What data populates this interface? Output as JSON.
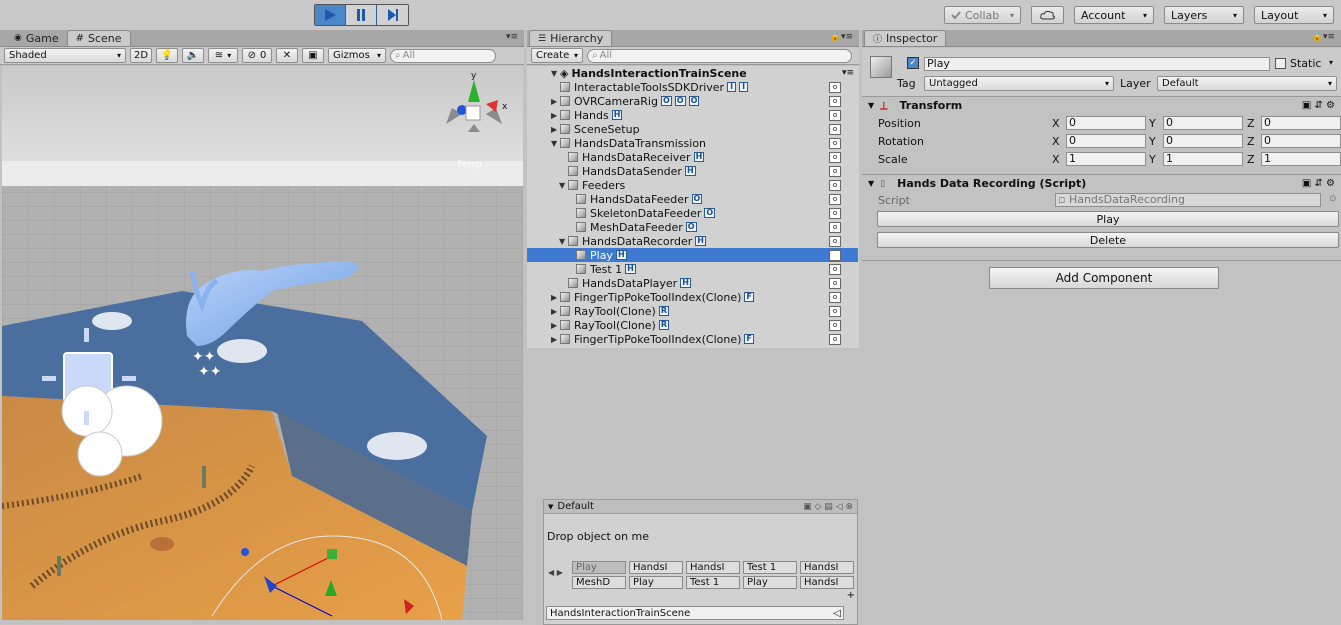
{
  "toolbar": {
    "collab_label": "Collab",
    "account_label": "Account",
    "layers_label": "Layers",
    "layout_label": "Layout"
  },
  "scene_panel": {
    "tab_game": "Game",
    "tab_scene": "Scene",
    "shading_mode": "Shaded",
    "mode_2d": "2D",
    "hidden_count": "0",
    "gizmos_label": "Gizmos",
    "search_placeholder": "All",
    "gizmo_axis_y": "y",
    "gizmo_axis_x": "x",
    "gizmo_view": "Persp"
  },
  "hierarchy_panel": {
    "tab_title": "Hierarchy",
    "create_label": "Create",
    "search_placeholder": "All",
    "scene_name": "HandsInteractionTrainScene",
    "rows": [
      {
        "label": "InteractableToolsSDKDriver",
        "badges": [
          "I",
          "I"
        ]
      },
      {
        "label": "OVRCameraRig",
        "badges": [
          "O",
          "O",
          "O"
        ]
      },
      {
        "label": "Hands",
        "badges": [
          "H"
        ]
      },
      {
        "label": "SceneSetup",
        "badges": []
      },
      {
        "label": "HandsDataTransmission",
        "badges": []
      },
      {
        "label": "HandsDataReceiver",
        "badges": [
          "H"
        ]
      },
      {
        "label": "HandsDataSender",
        "badges": [
          "H"
        ]
      },
      {
        "label": "Feeders",
        "badges": []
      },
      {
        "label": "HandsDataFeeder",
        "badges": [
          "O"
        ]
      },
      {
        "label": "SkeletonDataFeeder",
        "badges": [
          "O"
        ]
      },
      {
        "label": "MeshDataFeeder",
        "badges": [
          "O"
        ]
      },
      {
        "label": "HandsDataRecorder",
        "badges": [
          "H"
        ]
      },
      {
        "label": "Play",
        "badges": [
          "H"
        ]
      },
      {
        "label": "Test 1",
        "badges": [
          "H"
        ]
      },
      {
        "label": "HandsDataPlayer",
        "badges": [
          "H"
        ]
      },
      {
        "label": "FingerTipPokeToolIndex(Clone)",
        "badges": [
          "F"
        ]
      },
      {
        "label": "RayTool(Clone)",
        "badges": [
          "R"
        ]
      },
      {
        "label": "RayTool(Clone)",
        "badges": [
          "R"
        ]
      },
      {
        "label": "FingerTipPokeToolIndex(Clone)",
        "badges": [
          "F"
        ]
      }
    ]
  },
  "default_panel": {
    "title": "Default",
    "drop_hint": "Drop object on me",
    "slots_row1": [
      "Play",
      "HandsI",
      "HandsI",
      "Test 1",
      "HandsI"
    ],
    "slots_row2": [
      "MeshD",
      "Play",
      "Test 1",
      "Play",
      "HandsI"
    ],
    "scene_field": "HandsInteractionTrainScene"
  },
  "inspector": {
    "tab_title": "Inspector",
    "object_name": "Play",
    "static_label": "Static",
    "tag_label": "Tag",
    "tag_value": "Untagged",
    "layer_label": "Layer",
    "layer_value": "Default",
    "transform_title": "Transform",
    "position_label": "Position",
    "rotation_label": "Rotation",
    "scale_label": "Scale",
    "axis_x": "X",
    "axis_y": "Y",
    "axis_z": "Z",
    "position": [
      "0",
      "0",
      "0"
    ],
    "rotation": [
      "0",
      "0",
      "0"
    ],
    "scale": [
      "1",
      "1",
      "1"
    ],
    "script_component_title": "Hands Data Recording (Script)",
    "script_label": "Script",
    "script_value": "HandsDataRecording",
    "play_button": "Play",
    "delete_button": "Delete",
    "add_component_button": "Add Component"
  },
  "colors": {
    "selection": "#3e7ad1",
    "play_active": "#4a86c8",
    "desert_sand": "#d89544"
  }
}
